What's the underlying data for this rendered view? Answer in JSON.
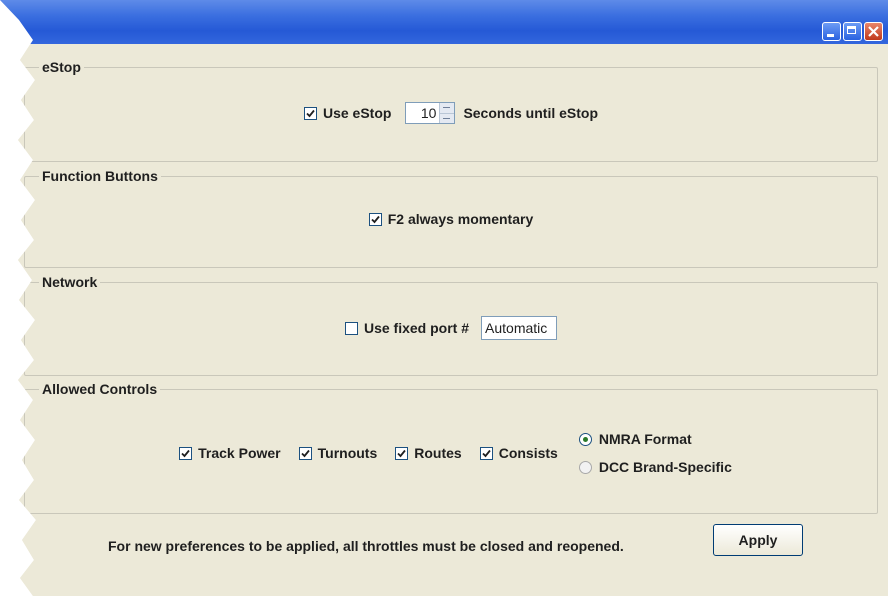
{
  "window": {
    "title": "",
    "controls": [
      "minimize-icon",
      "maximize-icon",
      "close-icon"
    ]
  },
  "estop": {
    "title": "eStop",
    "use_label": "Use eStop",
    "use_checked": true,
    "seconds_value": "10",
    "seconds_label": "Seconds until eStop"
  },
  "function_buttons": {
    "title": "Function Buttons",
    "f2_label": "F2 always momentary",
    "f2_checked": true
  },
  "network": {
    "title": "Network",
    "fixed_port_label": "Use fixed port #",
    "fixed_port_checked": false,
    "port_value": "Automatic"
  },
  "allowed_controls": {
    "title": "Allowed Controls",
    "track_power": "Track Power",
    "turnouts": "Turnouts",
    "routes": "Routes",
    "consists": "Consists",
    "nmra_format": "NMRA Format",
    "dcc_brand": "DCC Brand-Specific",
    "selected_format": "NMRA Format"
  },
  "footer": {
    "note": "For new preferences to be applied, all throttles must be closed and reopened.",
    "apply_label": "Apply"
  },
  "colors": {
    "titlebar": "#2559d6",
    "panel_bg": "#ece9d8",
    "close_button": "#c0391b"
  }
}
